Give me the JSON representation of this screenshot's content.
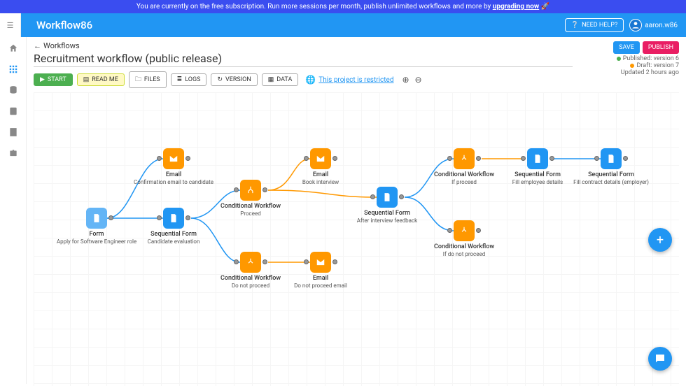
{
  "banner": {
    "text_pre": "You are currently on the free subscription. Run more sessions per month, publish unlimited workflows and more by ",
    "text_bold": "upgrading now",
    "emoji": "🚀"
  },
  "brand": "Workflow86",
  "need_help": "NEED HELP?",
  "user": "aaron.w86",
  "back_label": "Workflows",
  "title": "Recruitment workflow (public release)",
  "toolbar": {
    "start": "START",
    "readme": "READ ME",
    "files": "FILES",
    "logs": "LOGS",
    "version": "VERSION",
    "data": "DATA",
    "restricted": "This project is restricted"
  },
  "publish": {
    "save": "SAVE",
    "publish": "PUBLISH",
    "published": "Published: version 6",
    "draft": "Draft: version 7",
    "updated": "Updated 2 hours ago"
  },
  "nodes": {
    "form": {
      "type": "Form",
      "sub": "Apply for Software Engineer role"
    },
    "email1": {
      "type": "Email",
      "sub": "Confirmation email to candidate"
    },
    "seq1": {
      "type": "Sequential Form",
      "sub": "Candidate evaluation"
    },
    "cond1": {
      "type": "Conditional Workflow",
      "sub": "Proceed"
    },
    "cond2": {
      "type": "Conditional Workflow",
      "sub": "Do not proceed"
    },
    "email2": {
      "type": "Email",
      "sub": "Book interview"
    },
    "email3": {
      "type": "Email",
      "sub": "Do not proceed email"
    },
    "seq2": {
      "type": "Sequential Form",
      "sub": "After interview feedback"
    },
    "cond3": {
      "type": "Conditional Workflow",
      "sub": "If proceed"
    },
    "cond4": {
      "type": "Conditional Workflow",
      "sub": "If do not proceed"
    },
    "seq3": {
      "type": "Sequential Form",
      "sub": "Fill employee details"
    },
    "seq4": {
      "type": "Sequential Form",
      "sub": "Fill contract details (employer)"
    }
  }
}
